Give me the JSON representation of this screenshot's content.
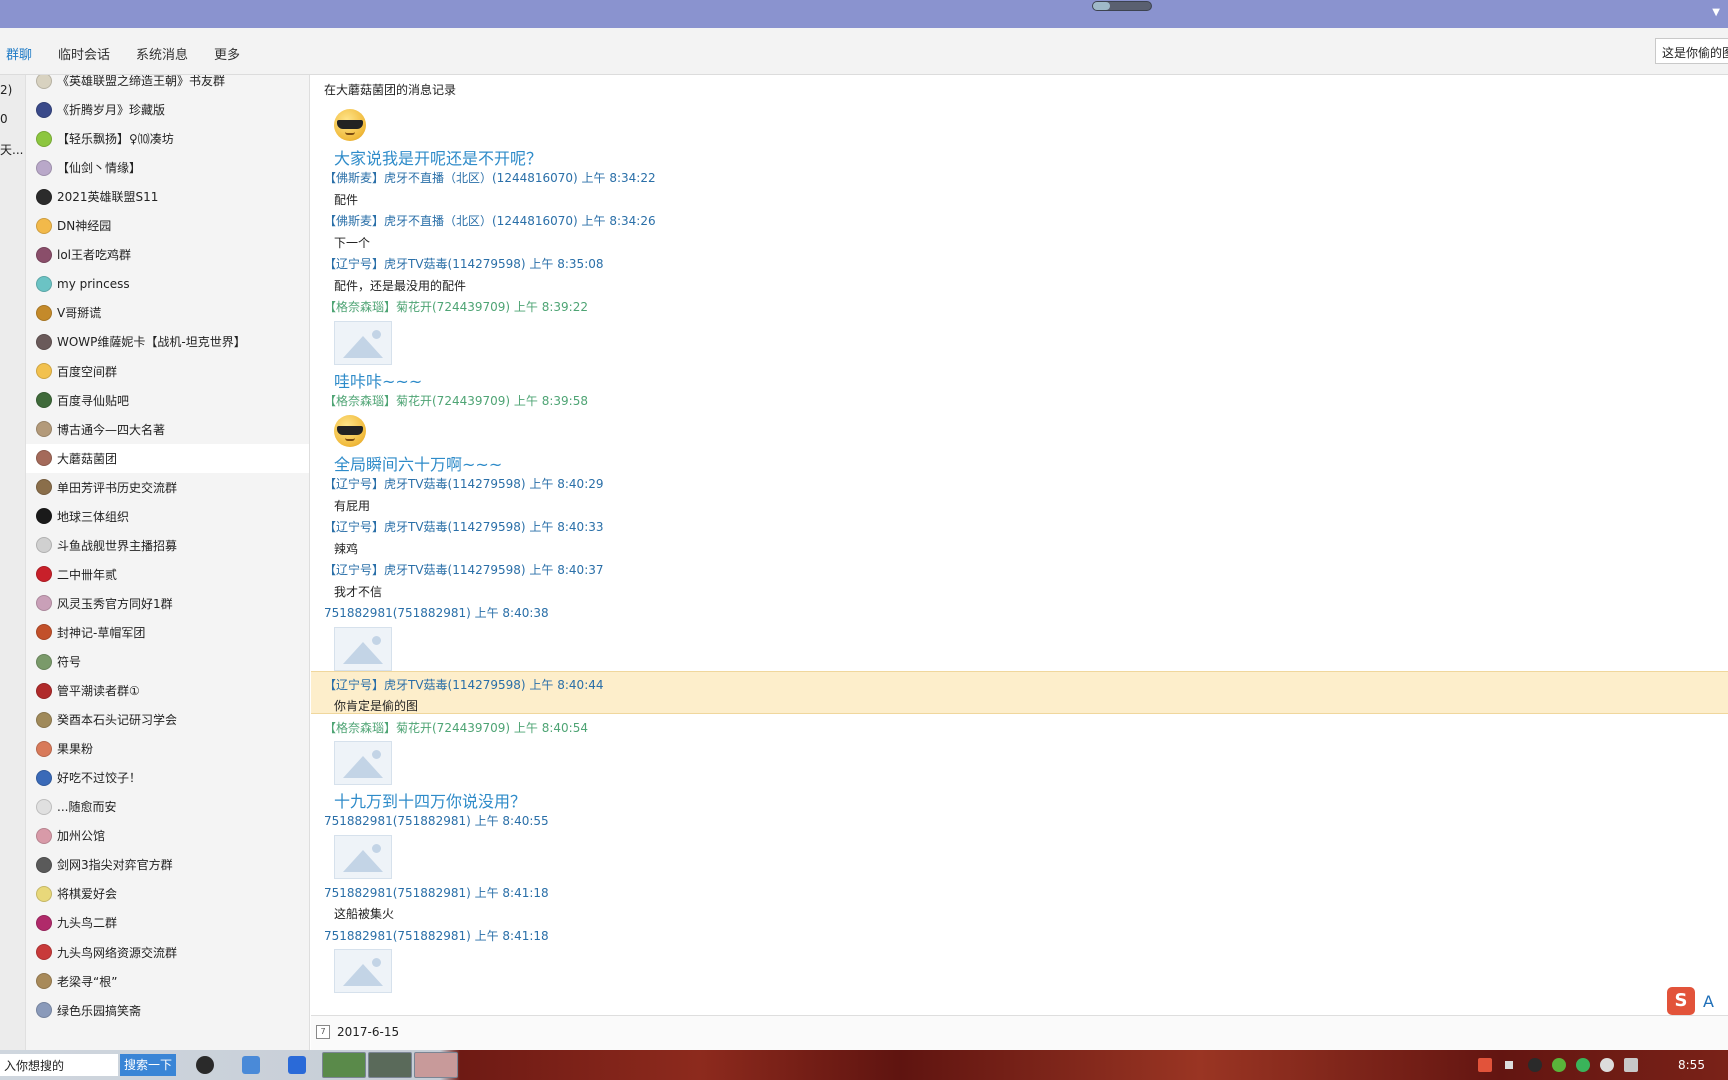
{
  "titlebar": {
    "progress_fraction": 0.3
  },
  "tabs": {
    "items": [
      {
        "label": "群聊",
        "active": true
      },
      {
        "label": "临时会话",
        "active": false
      },
      {
        "label": "系统消息",
        "active": false
      },
      {
        "label": "更多",
        "active": false
      }
    ],
    "search_value": "这是你偷的图"
  },
  "left_strip": [
    "2)",
    "0",
    "天..."
  ],
  "groups": [
    {
      "name": "《英雄联盟之缔造王朝》书友群",
      "color": "#d8d2c0"
    },
    {
      "name": "《折腾岁月》珍藏版",
      "color": "#3a4a8a"
    },
    {
      "name": "【轻乐飘扬】♀⑽凑坊",
      "color": "#8cc63f"
    },
    {
      "name": "【仙剑丶情缘】",
      "color": "#b9a8c9"
    },
    {
      "name": "2021英雄联盟S11",
      "color": "#2b2b2b"
    },
    {
      "name": "DN神经园",
      "color": "#f2b94a"
    },
    {
      "name": "lol王者吃鸡群",
      "color": "#8a4e6a"
    },
    {
      "name": "my princess",
      "color": "#6bc3c4"
    },
    {
      "name": "V哥掰谎",
      "color": "#c48a2a"
    },
    {
      "name": "WOWP维薩妮卡【战机-坦克世界】",
      "color": "#6a5a5a"
    },
    {
      "name": "百度空间群",
      "color": "#f2c14e"
    },
    {
      "name": "百度寻仙贴吧",
      "color": "#3f6a3a"
    },
    {
      "name": "博古通今—四大名著",
      "color": "#b39a7a"
    },
    {
      "name": "大蘑菇菌团",
      "color": "#a46a5a",
      "selected": true
    },
    {
      "name": "单田芳评书历史交流群",
      "color": "#8a6e4a"
    },
    {
      "name": "地球三体组织",
      "color": "#1a1a1a"
    },
    {
      "name": "斗鱼战舰世界主播招募",
      "color": "#d0d0d0"
    },
    {
      "name": "二中卌年贰",
      "color": "#c8202a"
    },
    {
      "name": "风灵玉秀官方同好1群",
      "color": "#c9a0b8"
    },
    {
      "name": "封神记-草帽军团",
      "color": "#c2502a"
    },
    {
      "name": "符号",
      "color": "#7a9a6a"
    },
    {
      "name": "管平潮读者群①",
      "color": "#b02a2a"
    },
    {
      "name": "癸酉本石头记研习学会",
      "color": "#a08a5a"
    },
    {
      "name": "果果粉",
      "color": "#d87a5a"
    },
    {
      "name": "好吃不过饺子！",
      "color": "#3a6ab8"
    },
    {
      "name": "...随愈而安",
      "color": "#e0e0e0"
    },
    {
      "name": "加州公馆",
      "color": "#d89aa8"
    },
    {
      "name": "剑网3指尖对弈官方群",
      "color": "#5a5a5a"
    },
    {
      "name": "将棋爱好会",
      "color": "#e8d87a"
    },
    {
      "name": "九头鸟二群",
      "color": "#b02a6a"
    },
    {
      "name": "九头鸟网络资源交流群",
      "color": "#c83a3a"
    },
    {
      "name": "老梁寻“根”",
      "color": "#a88a5a"
    },
    {
      "name": "绿色乐园搞笑斋",
      "color": "#8a9aba"
    }
  ],
  "chat": {
    "title": "在大蘑菇菌团的消息记录",
    "entries": [
      {
        "type": "emoji",
        "name": "cool-emoji"
      },
      {
        "type": "big",
        "text": "大家说我是开呢还是不开呢？"
      },
      {
        "type": "meta",
        "text": "【佛斯麦】虎牙不直播（北区）(1244816070) 上午 8:34:22",
        "color": "blue"
      },
      {
        "type": "text",
        "text": "配件"
      },
      {
        "type": "meta",
        "text": "【佛斯麦】虎牙不直播（北区）(1244816070) 上午 8:34:26",
        "color": "blue"
      },
      {
        "type": "text",
        "text": "下一个"
      },
      {
        "type": "meta",
        "text": "【辽宁号】虎牙TV菇毒(114279598) 上午 8:35:08",
        "color": "blue"
      },
      {
        "type": "text",
        "text": "配件，还是最没用的配件"
      },
      {
        "type": "meta",
        "text": "【格奈森瑙】菊花开(724439709) 上午 8:39:22",
        "color": "green"
      },
      {
        "type": "image"
      },
      {
        "type": "big",
        "text": "哇咔咔~~~"
      },
      {
        "type": "meta",
        "text": "【格奈森瑙】菊花开(724439709) 上午 8:39:58",
        "color": "green"
      },
      {
        "type": "emoji",
        "name": "cool-emoji"
      },
      {
        "type": "big",
        "text": "全局瞬间六十万啊~~~"
      },
      {
        "type": "meta",
        "text": "【辽宁号】虎牙TV菇毒(114279598) 上午 8:40:29",
        "color": "blue"
      },
      {
        "type": "text",
        "text": "有屁用"
      },
      {
        "type": "meta",
        "text": "【辽宁号】虎牙TV菇毒(114279598) 上午 8:40:33",
        "color": "blue"
      },
      {
        "type": "text",
        "text": "辣鸡"
      },
      {
        "type": "meta",
        "text": "【辽宁号】虎牙TV菇毒(114279598) 上午 8:40:37",
        "color": "blue"
      },
      {
        "type": "text",
        "text": "我才不信"
      },
      {
        "type": "meta",
        "text": "751882981(751882981) 上午 8:40:38",
        "color": "blue"
      },
      {
        "type": "image"
      },
      {
        "type": "meta",
        "text": "【辽宁号】虎牙TV菇毒(114279598) 上午 8:40:44",
        "color": "blue",
        "highlight": true
      },
      {
        "type": "text",
        "text": "你肯定是偷的图",
        "highlight": true
      },
      {
        "type": "meta",
        "text": "【格奈森瑙】菊花开(724439709) 上午 8:40:54",
        "color": "green"
      },
      {
        "type": "image"
      },
      {
        "type": "big",
        "text": "十九万到十四万你说没用？"
      },
      {
        "type": "meta",
        "text": "751882981(751882981) 上午 8:40:55",
        "color": "blue"
      },
      {
        "type": "image"
      },
      {
        "type": "meta",
        "text": "751882981(751882981) 上午 8:41:18",
        "color": "blue"
      },
      {
        "type": "text",
        "text": "这船被集火"
      },
      {
        "type": "meta",
        "text": "751882981(751882981) 上午 8:41:18",
        "color": "blue"
      },
      {
        "type": "image"
      }
    ]
  },
  "footer": {
    "date": "2017-6-15",
    "calendar_glyph": "7"
  },
  "ime": {
    "s": "S",
    "a": "A"
  },
  "taskbar": {
    "search_text": "入你想搜的",
    "search_button": "搜索一下",
    "clock": "8:55"
  },
  "colors": {
    "titlebar": "#8a93cf",
    "accent": "#1f7bc6",
    "meta_blue": "#2a6fa8",
    "meta_green": "#4ea474",
    "big_text": "#2e8bc9",
    "highlight": "#fdeecb"
  }
}
